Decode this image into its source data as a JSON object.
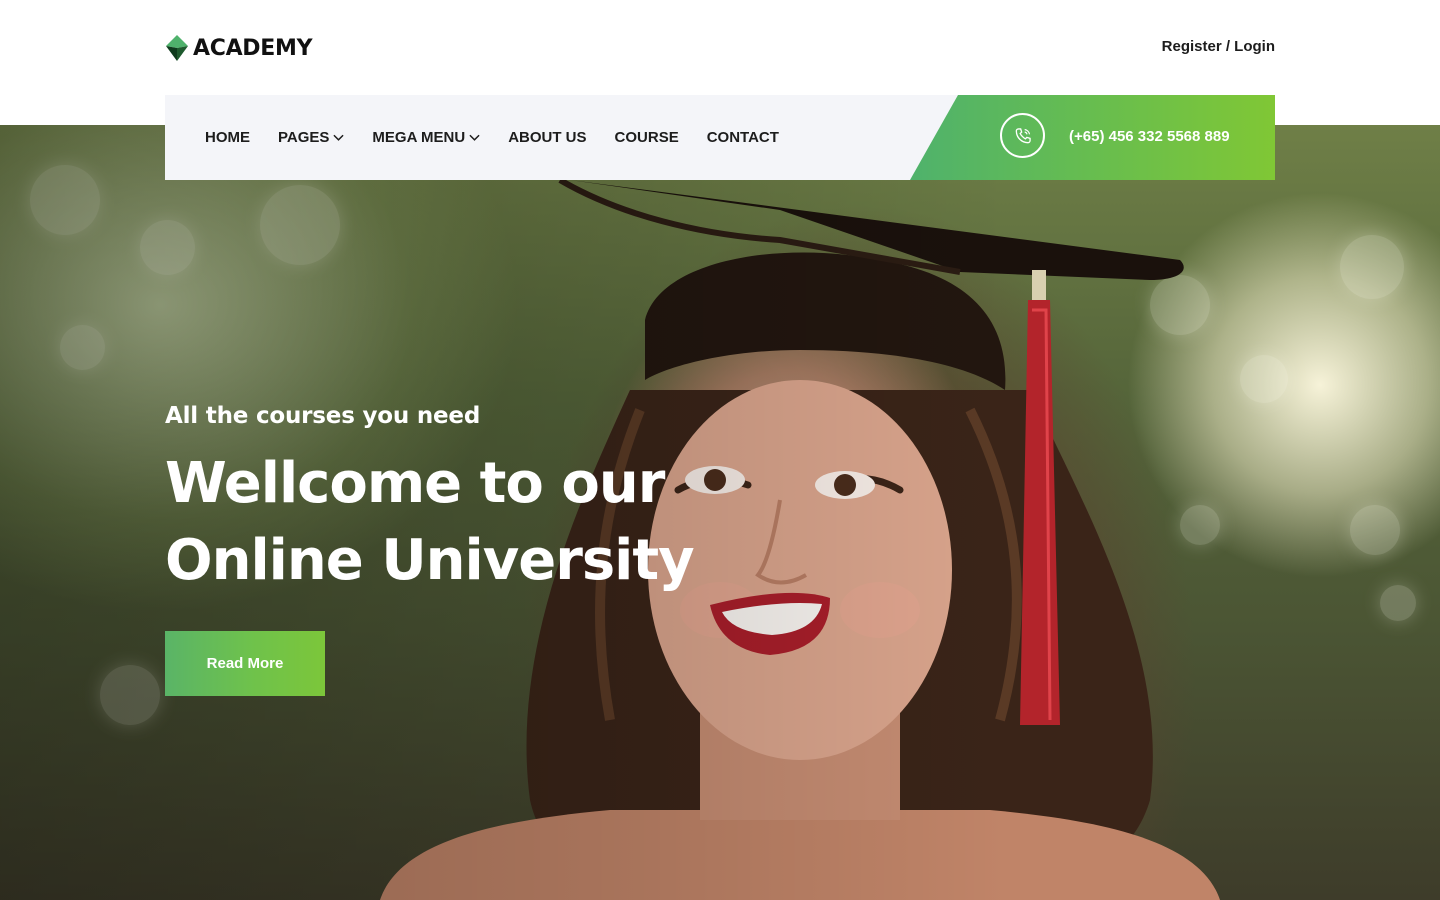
{
  "brand": {
    "name": "ACADEMY",
    "logo_icon": "diamond-logo-icon",
    "colors": {
      "green_primary": "#5ab467",
      "green_accent": "#80c735",
      "mark_dark": "#0f3b1d"
    }
  },
  "header": {
    "auth_link": "Register / Login"
  },
  "nav": {
    "items": [
      {
        "label": "HOME",
        "has_dropdown": false
      },
      {
        "label": "PAGES",
        "has_dropdown": true
      },
      {
        "label": "MEGA MENU",
        "has_dropdown": true
      },
      {
        "label": "ABOUT US",
        "has_dropdown": false
      },
      {
        "label": "COURSE",
        "has_dropdown": false
      },
      {
        "label": "CONTACT",
        "has_dropdown": false
      }
    ],
    "contact": {
      "icon": "phone-icon",
      "phone": "(+65) 456 332 5568 889"
    }
  },
  "hero": {
    "tagline": "All the courses you need",
    "title_line1": "Wellcome to our",
    "title_line2": "Online University",
    "cta_label": "Read More"
  }
}
